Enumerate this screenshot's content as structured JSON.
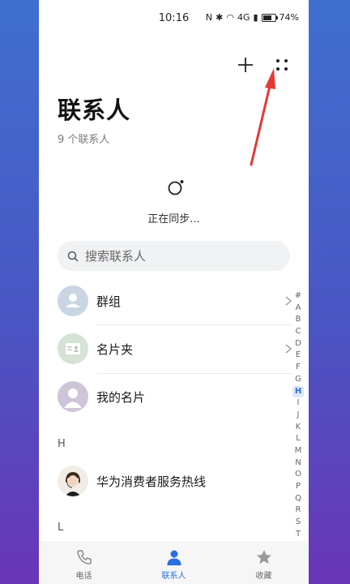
{
  "status": {
    "time": "10:16",
    "battery": "74%",
    "signal_text": "4G"
  },
  "header": {
    "title": "联系人",
    "count": "9 个联系人"
  },
  "sync": {
    "text": "正在同步..."
  },
  "search": {
    "placeholder": "搜索联系人"
  },
  "top_rows": [
    {
      "label": "群组"
    },
    {
      "label": "名片夹"
    },
    {
      "label": "我的名片"
    }
  ],
  "sections": [
    {
      "letter": "H",
      "contacts": [
        {
          "label": "华为消费者服务热线"
        }
      ]
    },
    {
      "letter": "L",
      "contacts": []
    }
  ],
  "alphabet": [
    "#",
    "A",
    "B",
    "C",
    "D",
    "E",
    "F",
    "G",
    "H",
    "I",
    "J",
    "K",
    "L",
    "M",
    "N",
    "O",
    "P",
    "Q",
    "R",
    "S",
    "T"
  ],
  "alphabet_active": "H",
  "nav": [
    {
      "label": "电话",
      "icon": "phone-icon"
    },
    {
      "label": "联系人",
      "icon": "person-icon"
    },
    {
      "label": "收藏",
      "icon": "star-icon"
    }
  ],
  "nav_active": "联系人",
  "colors": {
    "accent": "#2c6fe0",
    "arrow": "#e53935"
  }
}
